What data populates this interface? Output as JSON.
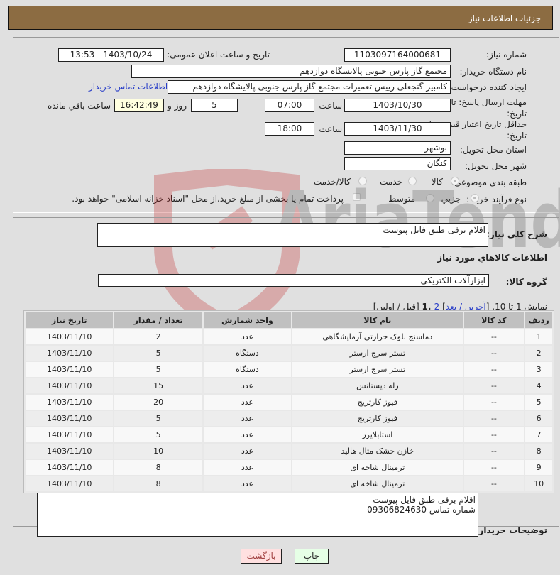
{
  "header": {
    "title": "جزئیات اطلاعات نیاز"
  },
  "form": {
    "need_number": {
      "label": "شماره نیاز:",
      "value": "1103097164000681"
    },
    "announce": {
      "label": "تاریخ و ساعت اعلان عمومی:",
      "value": "1403/10/24 - 13:53"
    },
    "buyer_org": {
      "label": "نام دستگاه خریدار:",
      "value": "مجتمع گاز پارس جنوبی  پالایشگاه دوازدهم"
    },
    "creator": {
      "label": "ایجاد کننده درخواست:",
      "value": "کامبیز گنجعلی رییس تعمیرات مجتمع گاز پارس جنوبی  پالایشگاه دوازدهم"
    },
    "contact_link": "اطلاعات تماس خریدار",
    "deadline": {
      "label_line1": "مهلت ارسال پاسخ: تا",
      "label_line2": "تاریخ:",
      "date": "1403/10/30",
      "time_label": "ساعت",
      "time": "07:00",
      "days": "5",
      "days_label": "روز و",
      "remaining": "16:42:49",
      "remaining_label": "ساعت باقي مانده"
    },
    "validity": {
      "label_line1": "حداقل تاریخ اعتبار قیمت: تا",
      "label_line2": "تاریخ:",
      "date": "1403/11/30",
      "time_label": "ساعت",
      "time": "18:00"
    },
    "province": {
      "label": "استان محل تحویل:",
      "value": "بوشهر"
    },
    "city": {
      "label": "شهر محل تحویل:",
      "value": "کنگان"
    },
    "category": {
      "label": "طبقه بندی موضوعی:",
      "options": [
        "کالا",
        "خدمت",
        "کالا/خدمت"
      ],
      "selected": "کالا"
    },
    "process": {
      "label": "نوع فرآیند خرید :",
      "options": [
        "جزیي",
        "متوسط"
      ],
      "selected": "جزیي",
      "treasury_note": "پرداخت تمام یا بخشی از مبلغ خرید،از محل \"اسناد خزانه اسلامی\" خواهد بود."
    }
  },
  "description": {
    "label": "شرح کلي نياز:",
    "value": "اقلام برقی طبق فایل پیوست"
  },
  "goods_section_title": "اطلاعات کالاهاي مورد نياز",
  "goods_group": {
    "label": "گروه کالا:",
    "value": "ابزارآلات الکتریکی"
  },
  "pagination": {
    "prefix": "نمایش 1 تا 10. [",
    "last_next": "آخرین / بعد",
    "suffix_open": "] ",
    "page2": "2",
    "sep": " ,",
    "page1": "1",
    "prev_first": " [قبل / اولین]"
  },
  "table": {
    "headers": [
      "ردیف",
      "کد کالا",
      "نام کالا",
      "واحد شمارش",
      "تعداد / مقدار",
      "تاریخ نیاز"
    ],
    "rows": [
      [
        "1",
        "--",
        "دماسنج بلوک حرارتی آزمایشگاهی",
        "عدد",
        "2",
        "1403/11/10"
      ],
      [
        "2",
        "--",
        "تستر سرج ارستر",
        "دستگاه",
        "5",
        "1403/11/10"
      ],
      [
        "3",
        "--",
        "تستر سرج ارستر",
        "دستگاه",
        "5",
        "1403/11/10"
      ],
      [
        "4",
        "--",
        "رله دیستانس",
        "عدد",
        "15",
        "1403/11/10"
      ],
      [
        "5",
        "--",
        "فیوز کارتریج",
        "عدد",
        "20",
        "1403/11/10"
      ],
      [
        "6",
        "--",
        "فیوز کارتریج",
        "عدد",
        "5",
        "1403/11/10"
      ],
      [
        "7",
        "--",
        "استابلایزر",
        "عدد",
        "5",
        "1403/11/10"
      ],
      [
        "8",
        "--",
        "خازن خشک متال هالید",
        "عدد",
        "10",
        "1403/11/10"
      ],
      [
        "9",
        "--",
        "ترمینال شاخه ای",
        "عدد",
        "8",
        "1403/11/10"
      ],
      [
        "10",
        "--",
        "ترمینال شاخه ای",
        "عدد",
        "8",
        "1403/11/10"
      ]
    ]
  },
  "buyer_notes": {
    "label": "توضیحات خریدار:",
    "value": "اقلام برقی طبق فایل پیوست\nشماره تماس 09306824630"
  },
  "buttons": {
    "print": "چاپ",
    "back": "بازگشت"
  },
  "watermark": {
    "text": "AriaTender.net"
  },
  "colors": {
    "header_bg": "#8c6c42",
    "link": "#2a3fc8",
    "print_bg": "#e6ffe6",
    "back_bg": "#ffe0e0",
    "remaining_bg": "#ffffe0"
  }
}
